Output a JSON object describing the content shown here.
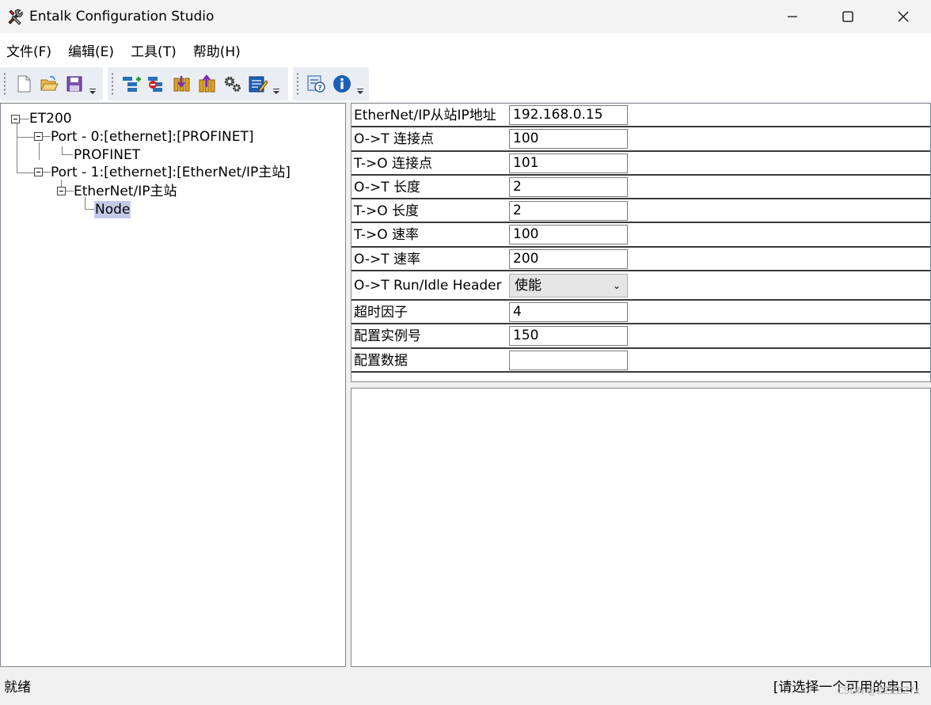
{
  "window": {
    "title": "Entalk Configuration Studio"
  },
  "menu": [
    "文件(F)",
    "编辑(E)",
    "工具(T)",
    "帮助(H)"
  ],
  "toolbar": {
    "groups": [
      [
        "new-file-icon",
        "open-folder-icon",
        "save-icon"
      ],
      [
        "add-node-icon",
        "remove-node-icon",
        "download-icon",
        "upload-icon",
        "settings-gears-icon",
        "edit-notes-icon"
      ],
      [
        "help-icon",
        "info-icon"
      ]
    ]
  },
  "tree": {
    "root": "ET200",
    "port0": "Port - 0:[ethernet]:[PROFINET]",
    "port0_child": "PROFINET",
    "port1": "Port - 1:[ethernet]:[EtherNet/IP主站]",
    "port1_child": "EtherNet/IP主站",
    "node": "Node"
  },
  "properties": [
    {
      "label": "EtherNet/IP从站IP地址",
      "value": "192.168.0.15"
    },
    {
      "label": "O->T 连接点",
      "value": "100"
    },
    {
      "label": "T->O 连接点",
      "value": "101"
    },
    {
      "label": "O->T 长度",
      "value": "2"
    },
    {
      "label": "T->O 长度",
      "value": "2"
    },
    {
      "label": "T->O 速率",
      "value": "100"
    },
    {
      "label": "O->T 速率",
      "value": "200"
    },
    {
      "label": "O->T Run/Idle Header",
      "value": "使能"
    },
    {
      "label": "超时因子",
      "value": "4"
    },
    {
      "label": "配置实例号",
      "value": "150"
    },
    {
      "label": "配置数据",
      "value": ""
    }
  ],
  "status": {
    "left": "就绪",
    "right": "[请选择一个可用的串口]"
  },
  "watermark": "CSDN @ZZZZZ?x"
}
